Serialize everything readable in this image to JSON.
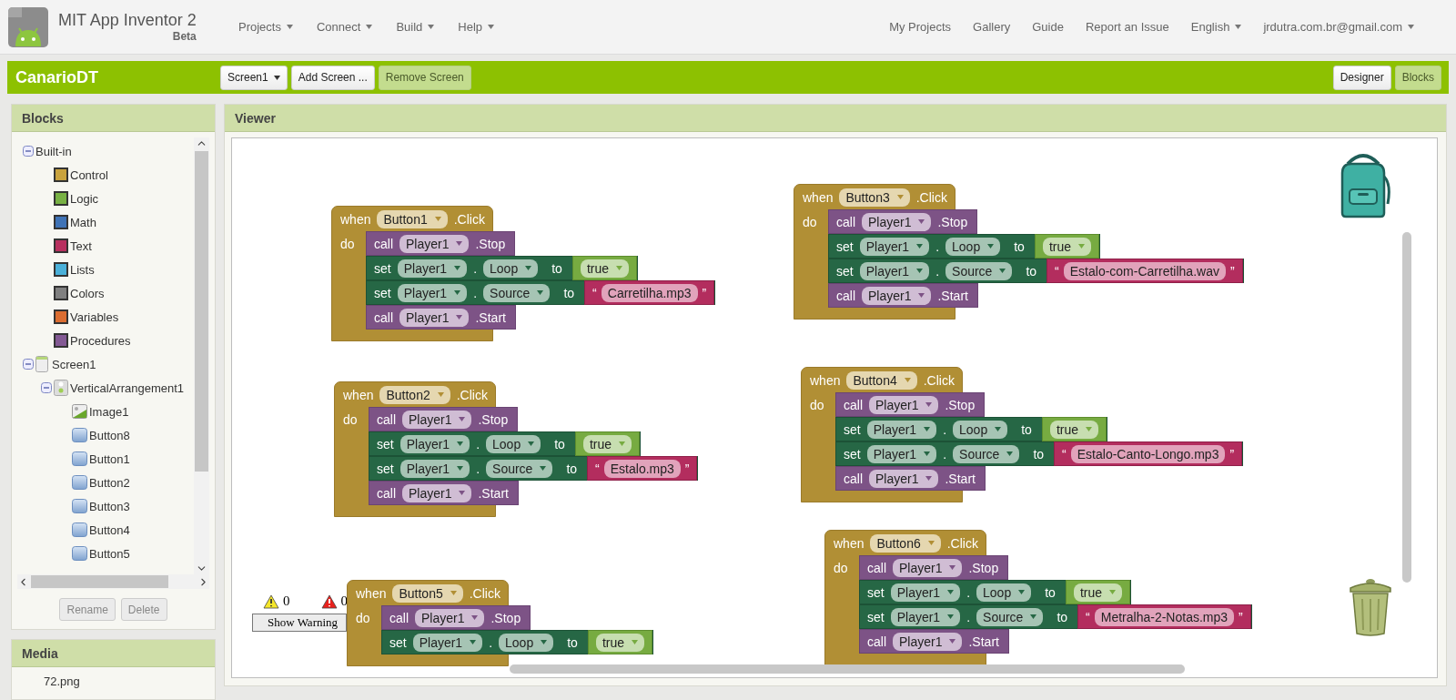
{
  "header": {
    "title": "MIT App Inventor 2",
    "subtitle": "Beta",
    "menus": [
      {
        "label": "Projects",
        "dropdown": true
      },
      {
        "label": "Connect",
        "dropdown": true
      },
      {
        "label": "Build",
        "dropdown": true
      },
      {
        "label": "Help",
        "dropdown": true
      }
    ],
    "links": [
      {
        "label": "My Projects",
        "dropdown": false
      },
      {
        "label": "Gallery",
        "dropdown": false
      },
      {
        "label": "Guide",
        "dropdown": false
      },
      {
        "label": "Report an Issue",
        "dropdown": false
      },
      {
        "label": "English",
        "dropdown": true
      },
      {
        "label": "jrdutra.com.br@gmail.com",
        "dropdown": true
      }
    ]
  },
  "project_bar": {
    "name": "CanarioDT",
    "screen_select": "Screen1",
    "buttons": [
      {
        "label": "Add Screen ...",
        "disabled": false
      },
      {
        "label": "Remove Screen",
        "disabled": true
      }
    ],
    "views": [
      {
        "label": "Designer",
        "selected": false
      },
      {
        "label": "Blocks",
        "selected": true
      }
    ]
  },
  "blocks_panel": {
    "title": "Blocks",
    "tree": [
      {
        "label": "Built-in",
        "kind": "group",
        "expanded": true,
        "children": [
          {
            "label": "Control",
            "kind": "category",
            "color": "#c9a33e"
          },
          {
            "label": "Logic",
            "kind": "category",
            "color": "#78b144"
          },
          {
            "label": "Math",
            "kind": "category",
            "color": "#3f73b6"
          },
          {
            "label": "Text",
            "kind": "category",
            "color": "#b8305f"
          },
          {
            "label": "Lists",
            "kind": "category",
            "color": "#4ab0d9"
          },
          {
            "label": "Colors",
            "kind": "category",
            "color": "#808080"
          },
          {
            "label": "Variables",
            "kind": "category",
            "color": "#db6d31"
          },
          {
            "label": "Procedures",
            "kind": "category",
            "color": "#835994"
          }
        ]
      },
      {
        "label": "Screen1",
        "kind": "screen",
        "expanded": true,
        "children": [
          {
            "label": "VerticalArrangement1",
            "kind": "arrangement",
            "expanded": true,
            "children": [
              {
                "label": "Image1",
                "kind": "image"
              },
              {
                "label": "Button8",
                "kind": "button"
              },
              {
                "label": "Button1",
                "kind": "button"
              },
              {
                "label": "Button2",
                "kind": "button"
              },
              {
                "label": "Button3",
                "kind": "button"
              },
              {
                "label": "Button4",
                "kind": "button"
              },
              {
                "label": "Button5",
                "kind": "button"
              }
            ]
          }
        ]
      }
    ],
    "buttons": [
      {
        "label": "Rename",
        "disabled": true
      },
      {
        "label": "Delete",
        "disabled": true
      }
    ]
  },
  "media_panel": {
    "title": "Media",
    "items": [
      {
        "label": "72.png"
      }
    ]
  },
  "viewer": {
    "title": "Viewer",
    "warnings": {
      "warning_count": "0",
      "error_count": "0",
      "toggle": "Show Warning"
    },
    "events": [
      {
        "when": "when",
        "component": "Button1",
        "event": ".Click",
        "do": "do",
        "statements": [
          {
            "kind": "call",
            "keyword": "call",
            "component": "Player1",
            "member": ".Stop"
          },
          {
            "kind": "set",
            "keyword": "set",
            "component": "Player1",
            "dot": ".",
            "property": "Loop",
            "to": "to",
            "value": {
              "kind": "logic",
              "text": "true"
            }
          },
          {
            "kind": "set",
            "keyword": "set",
            "component": "Player1",
            "dot": ".",
            "property": "Source",
            "to": "to",
            "value": {
              "kind": "text",
              "open": "“",
              "text": "Carretilha.mp3",
              "close": "”"
            }
          },
          {
            "kind": "call",
            "keyword": "call",
            "component": "Player1",
            "member": ".Start"
          }
        ]
      },
      {
        "when": "when",
        "component": "Button3",
        "event": ".Click",
        "do": "do",
        "statements": [
          {
            "kind": "call",
            "keyword": "call",
            "component": "Player1",
            "member": ".Stop"
          },
          {
            "kind": "set",
            "keyword": "set",
            "component": "Player1",
            "dot": ".",
            "property": "Loop",
            "to": "to",
            "value": {
              "kind": "logic",
              "text": "true"
            }
          },
          {
            "kind": "set",
            "keyword": "set",
            "component": "Player1",
            "dot": ".",
            "property": "Source",
            "to": "to",
            "value": {
              "kind": "text",
              "open": "“",
              "text": "Estalo-com-Carretilha.wav",
              "close": "”"
            }
          },
          {
            "kind": "call",
            "keyword": "call",
            "component": "Player1",
            "member": ".Start"
          }
        ]
      },
      {
        "when": "when",
        "component": "Button2",
        "event": ".Click",
        "do": "do",
        "statements": [
          {
            "kind": "call",
            "keyword": "call",
            "component": "Player1",
            "member": ".Stop"
          },
          {
            "kind": "set",
            "keyword": "set",
            "component": "Player1",
            "dot": ".",
            "property": "Loop",
            "to": "to",
            "value": {
              "kind": "logic",
              "text": "true"
            }
          },
          {
            "kind": "set",
            "keyword": "set",
            "component": "Player1",
            "dot": ".",
            "property": "Source",
            "to": "to",
            "value": {
              "kind": "text",
              "open": "“",
              "text": "Estalo.mp3",
              "close": "”"
            }
          },
          {
            "kind": "call",
            "keyword": "call",
            "component": "Player1",
            "member": ".Start"
          }
        ]
      },
      {
        "when": "when",
        "component": "Button4",
        "event": ".Click",
        "do": "do",
        "statements": [
          {
            "kind": "call",
            "keyword": "call",
            "component": "Player1",
            "member": ".Stop"
          },
          {
            "kind": "set",
            "keyword": "set",
            "component": "Player1",
            "dot": ".",
            "property": "Loop",
            "to": "to",
            "value": {
              "kind": "logic",
              "text": "true"
            }
          },
          {
            "kind": "set",
            "keyword": "set",
            "component": "Player1",
            "dot": ".",
            "property": "Source",
            "to": "to",
            "value": {
              "kind": "text",
              "open": "“",
              "text": "Estalo-Canto-Longo.mp3",
              "close": "”"
            }
          },
          {
            "kind": "call",
            "keyword": "call",
            "component": "Player1",
            "member": ".Start"
          }
        ]
      },
      {
        "when": "when",
        "component": "Button5",
        "event": ".Click",
        "do": "do",
        "statements": [
          {
            "kind": "call",
            "keyword": "call",
            "component": "Player1",
            "member": ".Stop"
          },
          {
            "kind": "set",
            "keyword": "set",
            "component": "Player1",
            "dot": ".",
            "property": "Loop",
            "to": "to",
            "value": {
              "kind": "logic",
              "text": "true"
            }
          }
        ]
      },
      {
        "when": "when",
        "component": "Button6",
        "event": ".Click",
        "do": "do",
        "statements": [
          {
            "kind": "call",
            "keyword": "call",
            "component": "Player1",
            "member": ".Stop"
          },
          {
            "kind": "set",
            "keyword": "set",
            "component": "Player1",
            "dot": ".",
            "property": "Loop",
            "to": "to",
            "value": {
              "kind": "logic",
              "text": "true"
            }
          },
          {
            "kind": "set",
            "keyword": "set",
            "component": "Player1",
            "dot": ".",
            "property": "Source",
            "to": "to",
            "value": {
              "kind": "text",
              "open": "“",
              "text": "Metralha-2-Notas.mp3",
              "close": "”"
            }
          },
          {
            "kind": "call",
            "keyword": "call",
            "component": "Player1",
            "member": ".Start"
          }
        ]
      }
    ]
  }
}
